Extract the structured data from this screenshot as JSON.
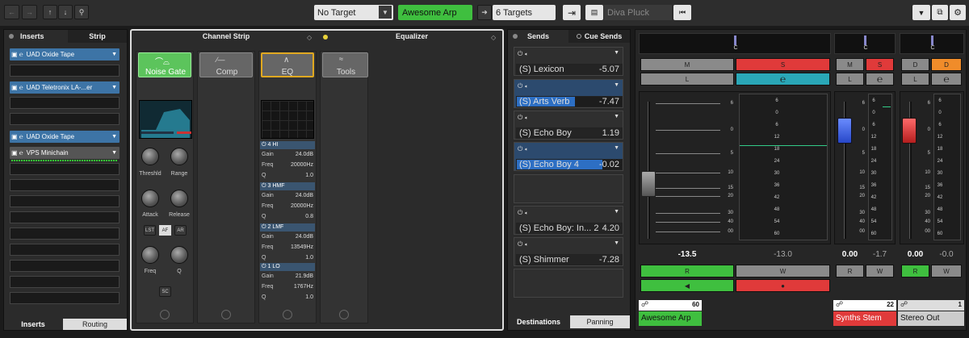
{
  "toolbar": {
    "no_target": "No Target",
    "awesome_arp": "Awesome Arp",
    "targets": "6 Targets",
    "diva": "Diva Pluck"
  },
  "inserts": {
    "tab_inserts": "Inserts",
    "tab_strip": "Strip",
    "slots": [
      "UAD Oxide Tape",
      "UAD Teletronix LA-...er",
      "UAD Oxide Tape",
      "VPS Minichain"
    ],
    "bottom_inserts": "Inserts",
    "bottom_routing": "Routing"
  },
  "channel_strip": {
    "title": "Channel Strip",
    "modules": [
      "Noise Gate",
      "Comp",
      "EQ",
      "Tools"
    ],
    "gate": {
      "threshold": "Threshld",
      "range": "Range",
      "attack": "Attack",
      "release": "Release",
      "freq": "Freq",
      "q": "Q",
      "lst": "LST",
      "af": "AF",
      "ar": "AR",
      "sc": "SC"
    },
    "eq_bands": [
      {
        "name": "4 HI",
        "gain": "24.0dB",
        "freq": "20000Hz",
        "q": "1.0"
      },
      {
        "name": "3 HMF",
        "gain": "24.0dB",
        "freq": "20000Hz",
        "q": "0.8"
      },
      {
        "name": "2 LMF",
        "gain": "24.0dB",
        "freq": "13549Hz",
        "q": "1.0"
      },
      {
        "name": "1 LO",
        "gain": "21.9dB",
        "freq": "1767Hz",
        "q": "1.0"
      }
    ],
    "labels": {
      "gain": "Gain",
      "freq": "Freq",
      "q": "Q"
    }
  },
  "equalizer": {
    "title": "Equalizer"
  },
  "sends": {
    "tab_sends": "Sends",
    "tab_cue": "Cue Sends",
    "items": [
      {
        "name": "(S) Lexicon",
        "value": "-5.07",
        "selected": false
      },
      {
        "name": "(S) Arts Verb",
        "value": "-7.47",
        "selected": true
      },
      {
        "name": "(S) Echo Boy",
        "value": "1.19",
        "selected": false
      },
      {
        "name": "(S) Echo Boy 4",
        "value": "-0.02",
        "selected": true
      },
      {
        "name": "(S) Echo Boy: In... 2",
        "value": "4.20",
        "selected": false
      },
      {
        "name": "(S) Shimmer",
        "value": "-7.28",
        "selected": false
      }
    ],
    "bottom_destinations": "Destinations",
    "bottom_panning": "Panning"
  },
  "mixer": {
    "pan": "C",
    "m": "M",
    "s": "S",
    "l": "L",
    "d": "D",
    "r": "R",
    "w": "W",
    "main_left": "-13.5",
    "main_right": "-13.0",
    "ch2_left": "0.00",
    "ch2_right": "-1.7",
    "ch3_left": "0.00",
    "ch3_right": "-0.0",
    "ch1_name": "Awesome Arp",
    "ch1_num": "60",
    "ch2_name": "Synths Stem",
    "ch2_num": "22",
    "ch3_name": "Stereo Out",
    "ch3_num": "1",
    "fader_scale": [
      "6",
      "0",
      "5",
      "10",
      "15",
      "20",
      "30",
      "40",
      "00"
    ],
    "meter_scale": [
      "6",
      "0",
      "6",
      "12",
      "18",
      "24",
      "30",
      "36",
      "42",
      "48",
      "54",
      "60"
    ],
    "colors": {
      "green": "#3fbf3f",
      "red": "#e03a3a",
      "teal": "#2aa7b7",
      "orange": "#f08c2a",
      "blue": "#3d74a6"
    }
  }
}
